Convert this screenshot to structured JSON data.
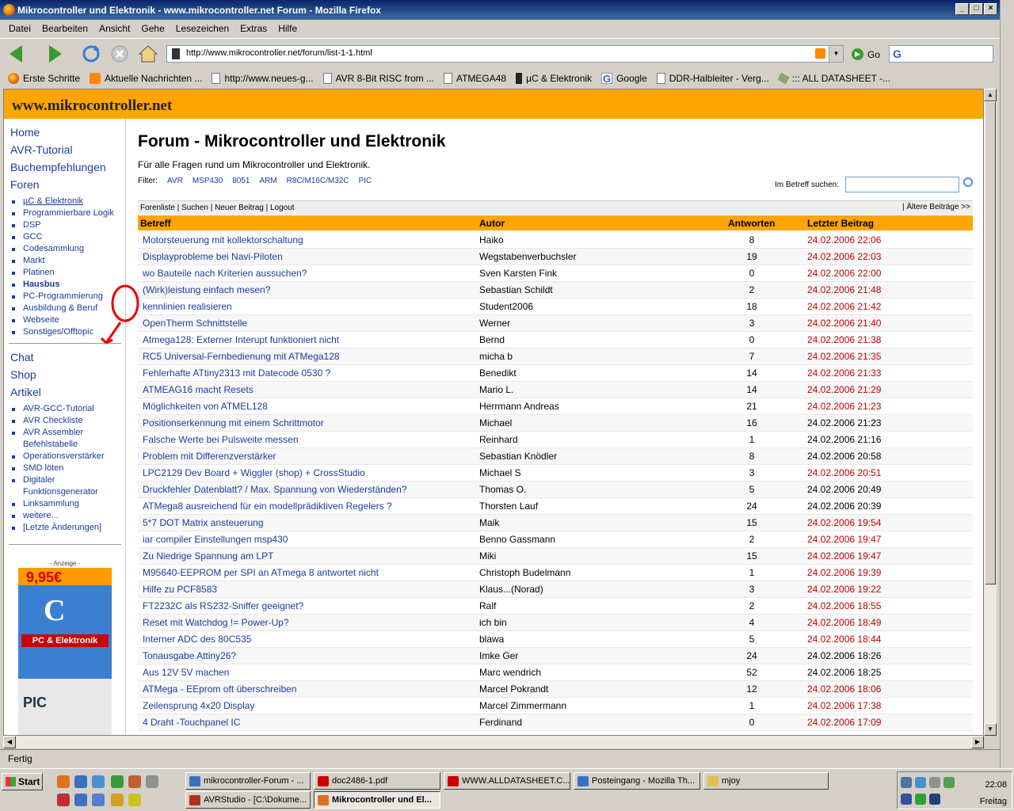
{
  "window": {
    "title": "Mikrocontroller und Elektronik - www.mikrocontroller.net Forum - Mozilla Firefox"
  },
  "menu": [
    "Datei",
    "Bearbeiten",
    "Ansicht",
    "Gehe",
    "Lesezeichen",
    "Extras",
    "Hilfe"
  ],
  "nav": {
    "url": "http://www.mikrocontroller.net/forum/list-1-1.html",
    "go_label": "Go"
  },
  "bookmarks": [
    "Erste Schritte",
    "Aktuelle Nachrichten ...",
    "http://www.neues-g...",
    "AVR 8-Bit RISC from ...",
    "ATMEGA48",
    "µC & Elektronik",
    "Google",
    "DDR-Halbleiter - Verg...",
    "::: ALL DATASHEET -..."
  ],
  "site": {
    "logo": "www.mikrocontroller.net"
  },
  "leftnav": {
    "main": [
      "Home",
      "AVR-Tutorial",
      "Buchempfehlungen",
      "Foren"
    ],
    "foren": [
      "µC & Elektronik",
      "Programmierbare Logik",
      "DSP",
      "GCC",
      "Codesammlung",
      "Markt",
      "Platinen",
      "Hausbus",
      "PC-Programmierung",
      "Ausbildung & Beruf",
      "Webseite",
      "Sonstiges/Offtopic"
    ],
    "other": [
      "Chat",
      "Shop",
      "Artikel"
    ],
    "artikel": [
      "AVR-GCC-Tutorial",
      "AVR Checkliste",
      "AVR Assembler Befehlstabelle",
      "Operationsverstärker",
      "SMD löten",
      "Digitaler Funktionsgenerator",
      "Linksammlung",
      "weitere...",
      "[Letzte Änderungen]"
    ],
    "ad_label": "- Anzeige -",
    "ad_price": "9,95€",
    "ad_c": "C",
    "ad_banner": "PC & Elektronik",
    "ad_pic": "PIC"
  },
  "forum": {
    "title": "Forum - Mikrocontroller und Elektronik",
    "subtitle": "Für alle Fragen rund um Mikrocontroller und Elektronik.",
    "filter_label": "Filter:",
    "filters": [
      "AVR",
      "MSP430",
      "8051",
      "ARM",
      "R8C/M16C/M32C",
      "PIC"
    ],
    "search_label": "Im Betreff suchen:",
    "actions": "Forenliste | Suchen | Neuer Beitrag | Logout",
    "older": "| Ältere Beiträge >>",
    "columns": [
      "Betreff",
      "Autor",
      "Antworten",
      "Letzter Beitrag"
    ],
    "rows": [
      {
        "t": "Motorsteuerung mit kollektorschaltung",
        "a": "Haiko",
        "n": "8",
        "d": "24.02.2006 22:06",
        "red": true
      },
      {
        "t": "Displayprobleme bei Navi-Piloten",
        "a": "Wegstabenverbuchsler",
        "n": "19",
        "d": "24.02.2006 22:03",
        "red": true
      },
      {
        "t": "wo Bauteile nach Kriterien aussuchen?",
        "a": "Sven Karsten Fink",
        "n": "0",
        "d": "24.02.2006 22:00",
        "red": true
      },
      {
        "t": "(Wirk)leistung einfach mesen?",
        "a": "Sebastian Schildt",
        "n": "2",
        "d": "24.02.2006 21:48",
        "red": true
      },
      {
        "t": "kennlinien realisieren",
        "a": "Student2006",
        "n": "18",
        "d": "24.02.2006 21:42",
        "red": true
      },
      {
        "t": "OpenTherm Schnittstelle",
        "a": "Werner",
        "n": "3",
        "d": "24.02.2006 21:40",
        "red": true
      },
      {
        "t": "Atmega128: Externer Interupt funktioniert nicht",
        "a": "Bernd",
        "n": "0",
        "d": "24.02.2006 21:38",
        "red": true
      },
      {
        "t": "RC5 Universal-Fernbedienung mit ATMega128",
        "a": "micha b",
        "n": "7",
        "d": "24.02.2006 21:35",
        "red": true
      },
      {
        "t": "Fehlerhafte ATtiny2313 mit Datecode 0530 ?",
        "a": "Benedikt",
        "n": "14",
        "d": "24.02.2006 21:33",
        "red": true
      },
      {
        "t": "ATMEAG16 macht Resets",
        "a": "Mario L.",
        "n": "14",
        "d": "24.02.2006 21:29",
        "red": true
      },
      {
        "t": "Möglichkeiten von ATMEL128",
        "a": "Herrmann Andreas",
        "n": "21",
        "d": "24.02.2006 21:23",
        "red": true
      },
      {
        "t": "Positionserkennung mit einem Schrittmotor",
        "a": "Michael",
        "n": "16",
        "d": "24.02.2006 21:23",
        "red": false
      },
      {
        "t": "Falsche Werte bei Pulsweite messen",
        "a": "Reinhard",
        "n": "1",
        "d": "24.02.2006 21:16",
        "red": false
      },
      {
        "t": "Problem mit Differenzverstärker",
        "a": "Sebastian Knödler",
        "n": "8",
        "d": "24.02.2006 20:58",
        "red": false
      },
      {
        "t": "LPC2129 Dev Board + Wiggler (shop) + CrossStudio",
        "a": "Michael S",
        "n": "3",
        "d": "24.02.2006 20:51",
        "red": true
      },
      {
        "t": "Druckfehler Datenblatt? / Max. Spannung von Wiederständen?",
        "a": "Thomas O.",
        "n": "5",
        "d": "24.02.2006 20:49",
        "red": false
      },
      {
        "t": "ATMega8 ausreichend für ein modellprädiktiven Regelers ?",
        "a": "Thorsten Lauf",
        "n": "24",
        "d": "24.02.2006 20:39",
        "red": false
      },
      {
        "t": "5*7 DOT Matrix ansteuerung",
        "a": "Maik",
        "n": "15",
        "d": "24.02.2006 19:54",
        "red": true
      },
      {
        "t": "iar compiler Einstellungen msp430",
        "a": "Benno Gassmann",
        "n": "2",
        "d": "24.02.2006 19:47",
        "red": true
      },
      {
        "t": "Zu Niedrige Spannung am LPT",
        "a": "Miki",
        "n": "15",
        "d": "24.02.2006 19:47",
        "red": true
      },
      {
        "t": "M95640-EEPROM per SPI an ATmega 8 antwortet nicht",
        "a": "Christoph Budelmann",
        "n": "1",
        "d": "24.02.2006 19:39",
        "red": true
      },
      {
        "t": "Hilfe zu PCF8583",
        "a": "Klaus...(Norad)",
        "n": "3",
        "d": "24.02.2006 19:22",
        "red": true
      },
      {
        "t": "FT2232C als RS232-Sniffer geeignet?",
        "a": "Ralf",
        "n": "2",
        "d": "24.02.2006 18:55",
        "red": true
      },
      {
        "t": "Reset mit Watchdog != Power-Up?",
        "a": "ich bin",
        "n": "4",
        "d": "24.02.2006 18:49",
        "red": true
      },
      {
        "t": "Interner ADC des 80C535",
        "a": "blawa",
        "n": "5",
        "d": "24.02.2006 18:44",
        "red": true
      },
      {
        "t": "Tonausgabe Attiny26?",
        "a": "Imke Ger",
        "n": "24",
        "d": "24.02.2006 18:26",
        "red": false
      },
      {
        "t": "Aus 12V 5V machen",
        "a": "Marc wendrich",
        "n": "52",
        "d": "24.02.2006 18:25",
        "red": false
      },
      {
        "t": "ATMega - EEprom oft überschreiben",
        "a": "Marcel Pokrandt",
        "n": "12",
        "d": "24.02.2006 18:06",
        "red": true
      },
      {
        "t": "Zeilensprung 4x20 Display",
        "a": "Marcel Zimmermann",
        "n": "1",
        "d": "24.02.2006 17:38",
        "red": true
      },
      {
        "t": "4 Draht -Touchpanel IC",
        "a": "Ferdinand",
        "n": "0",
        "d": "24.02.2006 17:09",
        "red": true
      }
    ]
  },
  "status": "Fertig",
  "taskbar": {
    "start": "Start",
    "tasks": [
      "mikrocontroller-Forum - ...",
      "doc2486-1.pdf",
      "WWW.ALLDATASHEET.C...",
      "Posteingang - Mozilla Th...",
      "mjoy",
      "AVRStudio - [C:\\Dokume...",
      "Mikrocontroller und El..."
    ],
    "clock": "22:08",
    "day": "Freitag"
  },
  "colors": {
    "site_orange": "#ffa500",
    "link_blue": "#1a3c9c",
    "new_red": "#c00000"
  }
}
